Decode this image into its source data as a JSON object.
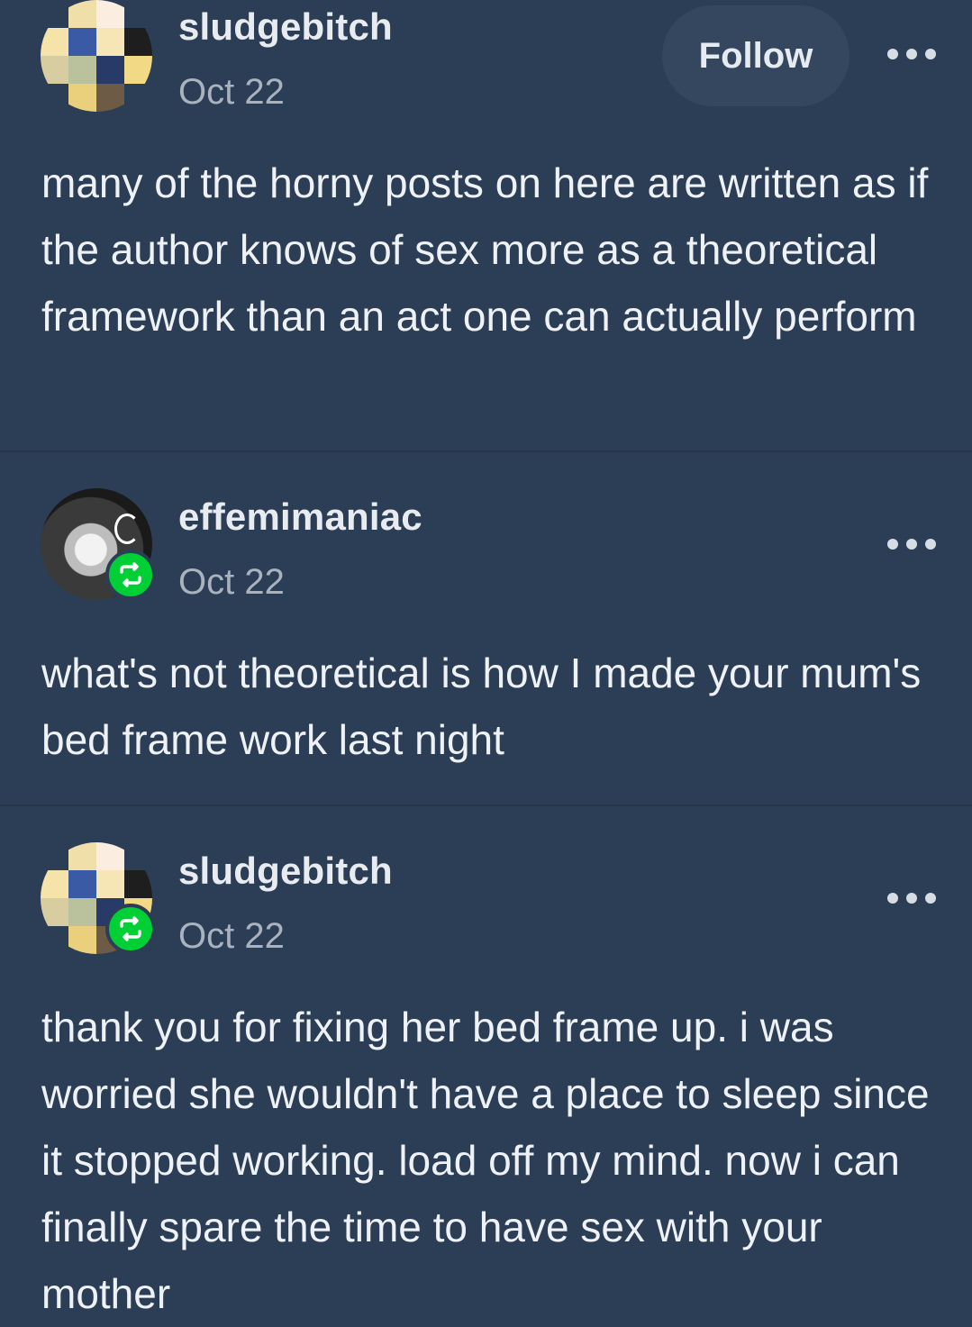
{
  "posts": [
    {
      "username": "sludgebitch",
      "date": "Oct 22",
      "follow_label": "Follow",
      "text": "many of the horny posts on here are written as if the author knows of sex more as a theoretical framework than an act one can actually perform"
    },
    {
      "username": "effemimaniac",
      "date": "Oct 22",
      "text": "what's not theoretical is how I made your mum's bed frame work last night"
    },
    {
      "username": "sludgebitch",
      "date": "Oct 22",
      "text": "thank you for fixing her bed frame up. i was worried she wouldn't have a place to sleep since it stopped working. load off my mind. now i can finally spare the time to have sex with your mother"
    }
  ],
  "colors": {
    "background": "#2c3e55",
    "reblog_badge": "#00cf35",
    "follow_button": "#34475f"
  },
  "icons": {
    "more": "more-options-icon",
    "reblog": "reblog-icon"
  }
}
